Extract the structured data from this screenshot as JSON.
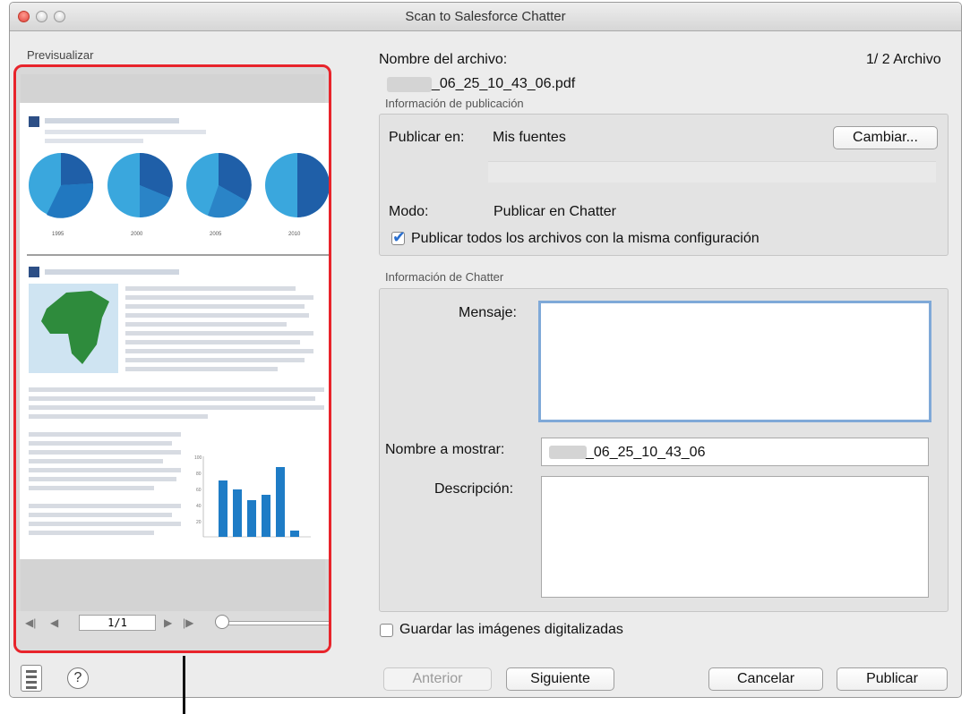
{
  "window": {
    "title": "Scan to Salesforce Chatter"
  },
  "preview": {
    "label": "Previsualizar",
    "page_field": "1/1",
    "chart_years": [
      "1995",
      "2000",
      "2005",
      "2010"
    ],
    "bar_axis_ticks": [
      "100",
      "80",
      "60",
      "40",
      "20"
    ]
  },
  "file": {
    "name_label": "Nombre del archivo:",
    "filename_suffix": "_06_25_10_43_06.pdf",
    "counter": "1/  2 Archivo"
  },
  "publication": {
    "group_label": "Información de publicación",
    "publish_in_label": "Publicar en:",
    "publish_in_value": "Mis fuentes",
    "change_button": "Cambiar...",
    "mode_label": "Modo:",
    "mode_value": "Publicar en Chatter",
    "same_config_label": "Publicar todos los archivos con la misma configuración",
    "same_config_checked": true
  },
  "chatter": {
    "group_label": "Información de Chatter",
    "message_label": "Mensaje:",
    "message_value": "",
    "display_name_label": "Nombre a mostrar:",
    "display_name_suffix": "_06_25_10_43_06",
    "description_label": "Descripción:",
    "description_value": ""
  },
  "save_images_label": "Guardar las imágenes digitalizadas",
  "save_images_checked": false,
  "buttons": {
    "previous": "Anterior",
    "next": "Siguiente",
    "cancel": "Cancelar",
    "publish": "Publicar"
  },
  "help_icon_glyph": "?",
  "colors": {
    "highlight": "#e8242b",
    "pie_light": "#3aa7dd",
    "pie_dark": "#1f5fa8",
    "bars": "#1e7cc6",
    "map_land": "#2e8b3c"
  }
}
